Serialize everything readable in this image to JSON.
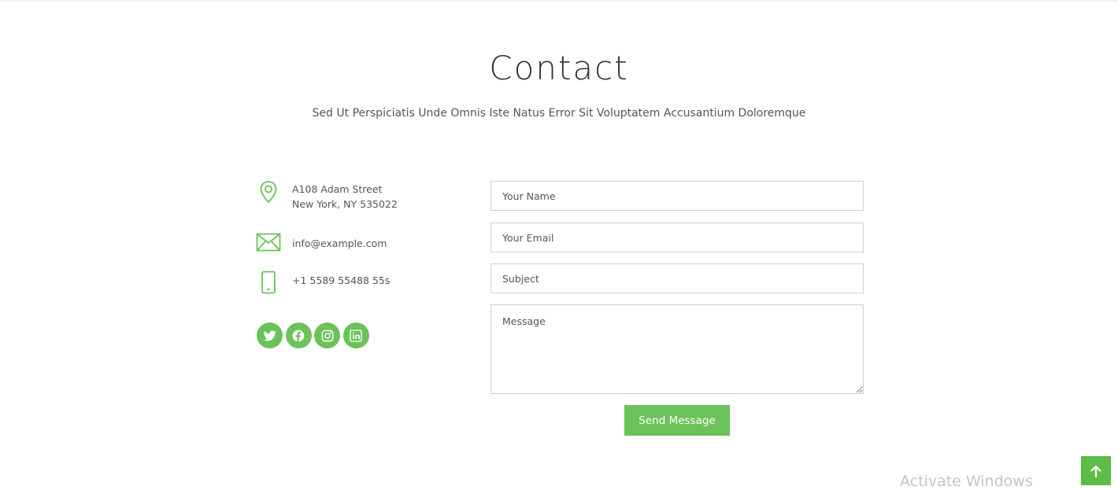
{
  "header": {
    "title": "Contact",
    "subtitle": "Sed Ut Perspiciatis Unde Omnis Iste Natus Error Sit Voluptatem Accusantium Doloremque"
  },
  "contact_info": {
    "address_line1": "A108 Adam Street",
    "address_line2": "New York, NY 535022",
    "email": "info@example.com",
    "phone": "+1 5589 55488 55s",
    "icons": [
      "map-pin-icon",
      "envelope-icon",
      "phone-icon"
    ]
  },
  "social": [
    {
      "name": "twitter-icon"
    },
    {
      "name": "facebook-icon"
    },
    {
      "name": "instagram-icon"
    },
    {
      "name": "linkedin-icon"
    }
  ],
  "form": {
    "name_placeholder": "Your Name",
    "email_placeholder": "Your Email",
    "subject_placeholder": "Subject",
    "message_placeholder": "Message",
    "name_value": "",
    "email_value": "",
    "subject_value": "",
    "message_value": "",
    "submit_label": "Send Message"
  },
  "overlay": {
    "watermark": "Activate Windows",
    "back_to_top_icon": "arrow-up-icon"
  },
  "colors": {
    "accent": "#6cc25a",
    "back_to_top": "#5cbc45"
  }
}
